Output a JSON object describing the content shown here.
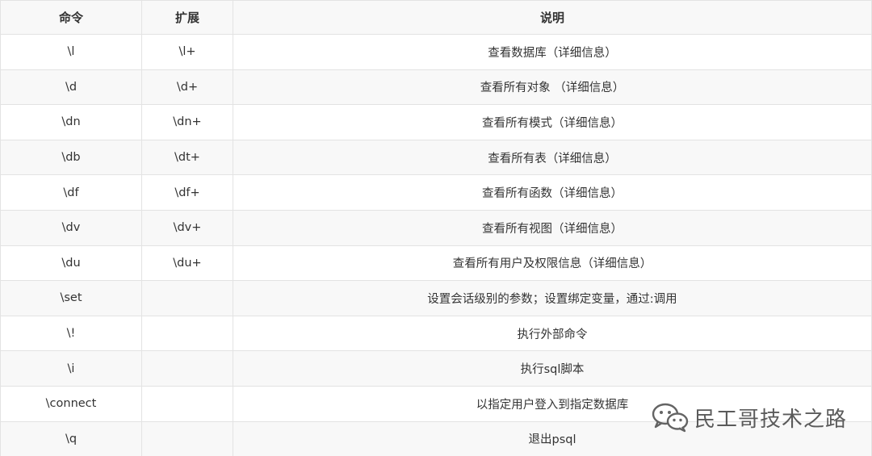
{
  "table": {
    "headers": [
      "命令",
      "扩展",
      "说明"
    ],
    "rows": [
      [
        "\\l",
        "\\l+",
        "查看数据库（详细信息）"
      ],
      [
        "\\d",
        "\\d+",
        "查看所有对象 （详细信息）"
      ],
      [
        "\\dn",
        "\\dn+",
        "查看所有模式（详细信息）"
      ],
      [
        "\\db",
        "\\dt+",
        "查看所有表（详细信息）"
      ],
      [
        "\\df",
        "\\df+",
        "查看所有函数（详细信息）"
      ],
      [
        "\\dv",
        "\\dv+",
        "查看所有视图（详细信息）"
      ],
      [
        "\\du",
        "\\du+",
        "查看所有用户及权限信息（详细信息）"
      ],
      [
        "\\set",
        "",
        "设置会话级别的参数；设置绑定变量，通过:调用"
      ],
      [
        "\\!",
        "",
        "执行外部命令"
      ],
      [
        "\\i",
        "",
        "执行sql脚本"
      ],
      [
        "\\connect",
        "",
        "以指定用户登入到指定数据库"
      ],
      [
        "\\q",
        "",
        "退出psql"
      ]
    ]
  },
  "watermark": {
    "text": "民工哥技术之路",
    "icon": "wechat-icon"
  }
}
